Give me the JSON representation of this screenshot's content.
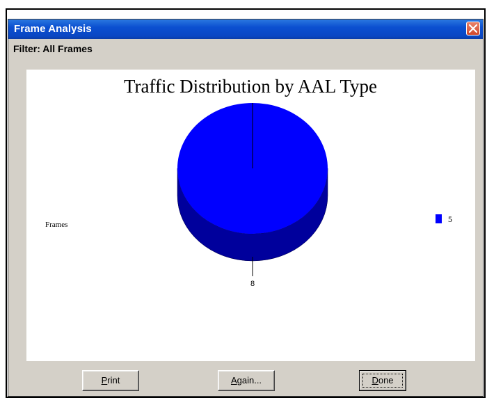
{
  "window": {
    "title": "Frame Analysis",
    "filter_label": "Filter: All Frames",
    "close_icon": "close-icon"
  },
  "buttons": {
    "print": {
      "accel": "P",
      "rest": "rint"
    },
    "again": {
      "accel": "A",
      "rest": "gain..."
    },
    "done": {
      "accel": "D",
      "rest": "one"
    }
  },
  "chart_data": {
    "type": "pie",
    "title": "Traffic Distribution by AAL Type",
    "ylabel": "Frames",
    "categories": [
      "5"
    ],
    "values": [
      8
    ],
    "data_labels": [
      "8"
    ],
    "legend": [
      {
        "name": "5",
        "color": "#0000ff"
      }
    ],
    "legend_position": "right",
    "colors": {
      "slice": "#0000ff",
      "slice_side": "#00009c"
    }
  }
}
